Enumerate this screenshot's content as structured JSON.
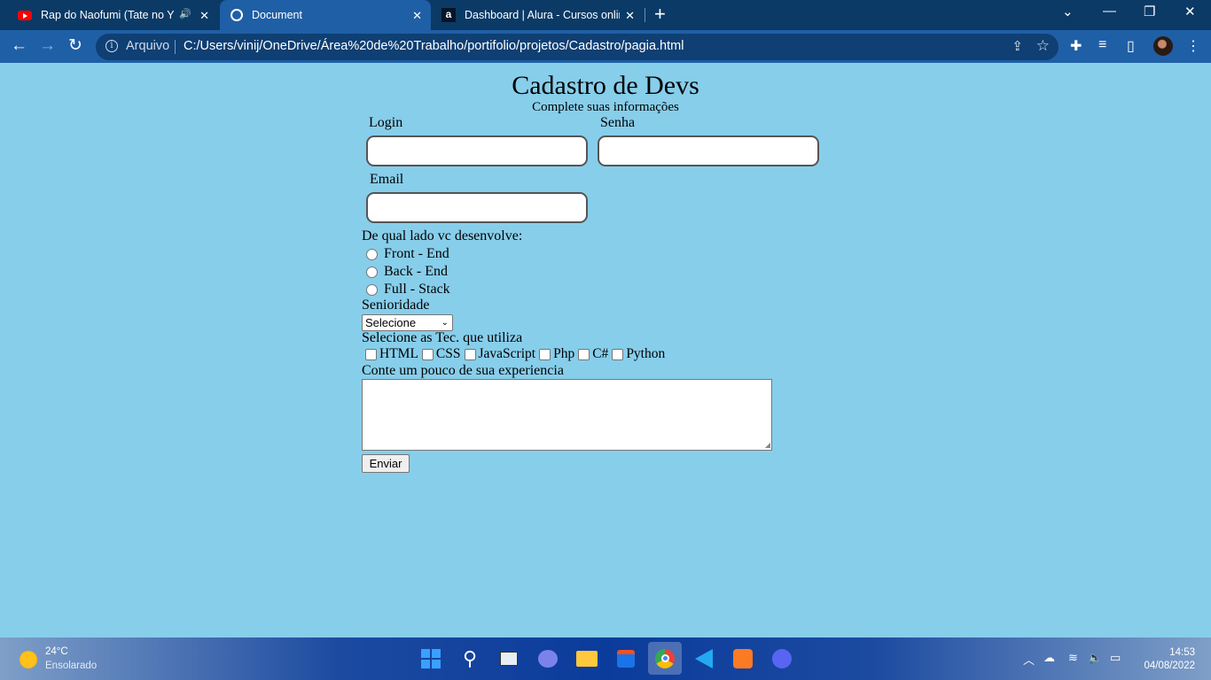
{
  "browser": {
    "tabs": [
      {
        "title": "Rap do Naofumi (Tate no Yu",
        "favicon": "youtube-icon"
      },
      {
        "title": "Document",
        "favicon": "globe-icon"
      },
      {
        "title": "Dashboard | Alura - Cursos online",
        "favicon": "alura-icon"
      }
    ],
    "address": {
      "scheme_label": "Arquivo",
      "url": "C:/Users/vinij/OneDrive/Área%20de%20Trabalho/portifolio/projetos/Cadastro/pagia.html"
    },
    "colors": {
      "tabbar": "#0b3a66",
      "toolbar": "#1f5fa6",
      "page_bg": "#87ceeb"
    }
  },
  "form": {
    "title": "Cadastro de Devs",
    "subtitle": "Complete suas informações",
    "login_label": "Login",
    "senha_label": "Senha",
    "email_label": "Email",
    "side_question": "De qual lado vc desenvolve:",
    "side_options": [
      "Front - End",
      "Back - End",
      "Full - Stack"
    ],
    "seniority_label": "Senioridade",
    "seniority_selected": "Selecione",
    "tech_label": "Selecione as Tec. que utiliza",
    "tech_options": [
      "HTML",
      "CSS",
      "JavaScript",
      "Php",
      "C#",
      "Python"
    ],
    "experience_label": "Conte um pouco de sua experiencia",
    "submit_label": "Enviar"
  },
  "taskbar": {
    "weather": {
      "temp": "24°C",
      "condition": "Ensolarado"
    },
    "clock": {
      "time": "14:53",
      "date": "04/08/2022"
    }
  }
}
